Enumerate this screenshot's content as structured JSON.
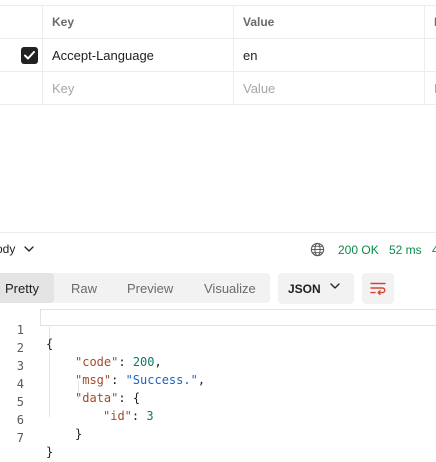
{
  "headers_table": {
    "columns": {
      "key": "Key",
      "value": "Value",
      "description": "D"
    },
    "rows": [
      {
        "checked": true,
        "key": "Accept-Language",
        "value": "en",
        "description": ""
      }
    ],
    "placeholder": {
      "key": "Key",
      "value": "Value",
      "description": "D"
    }
  },
  "response": {
    "body_label": "ody",
    "status": "200 OK",
    "time": "52 ms",
    "size": "4",
    "status_color": "#0b8a4a"
  },
  "view_tabs": {
    "items": [
      "Pretty",
      "Raw",
      "Preview",
      "Visualize"
    ],
    "active": "Pretty",
    "format": "JSON"
  },
  "editor": {
    "line_numbers": [
      "1",
      "2",
      "3",
      "4",
      "5",
      "6",
      "7"
    ],
    "lines": {
      "l1": "{",
      "code_key": "\"code\"",
      "code_val": "200",
      "msg_key": "\"msg\"",
      "msg_val": "\"Success.\"",
      "data_key": "\"data\"",
      "data_open": "{",
      "id_key": "\"id\"",
      "id_val": "3",
      "data_close": "}",
      "l7": "}"
    },
    "syntax_colors": {
      "key": "#a14b2a",
      "string": "#1d63c4",
      "number": "#0f7a6a"
    }
  },
  "icons": [
    "check-icon",
    "chevron-down-icon",
    "globe-icon",
    "wrap-lines-icon"
  ]
}
